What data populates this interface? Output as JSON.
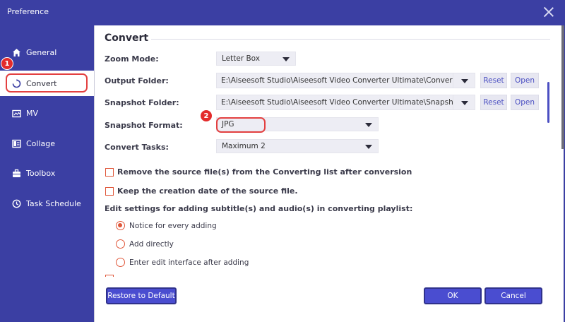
{
  "window": {
    "title": "Preference"
  },
  "sidebar": {
    "items": [
      {
        "label": "General",
        "icon": "home-icon"
      },
      {
        "label": "Convert",
        "icon": "convert-icon"
      },
      {
        "label": "MV",
        "icon": "mv-icon"
      },
      {
        "label": "Collage",
        "icon": "collage-icon"
      },
      {
        "label": "Toolbox",
        "icon": "toolbox-icon"
      },
      {
        "label": "Task Schedule",
        "icon": "clock-icon"
      }
    ],
    "active": "Convert"
  },
  "convert": {
    "section_title": "Convert",
    "zoom_mode": {
      "label": "Zoom Mode:",
      "value": "Letter Box"
    },
    "output_folder": {
      "label": "Output Folder:",
      "value": "E:\\Aiseesoft Studio\\Aiseesoft Video Converter Ultimate\\Converted",
      "reset": "Reset",
      "open": "Open"
    },
    "snapshot_folder": {
      "label": "Snapshot Folder:",
      "value": "E:\\Aiseesoft Studio\\Aiseesoft Video Converter Ultimate\\Snapshot",
      "reset": "Reset",
      "open": "Open"
    },
    "snapshot_format": {
      "label": "Snapshot Format:",
      "value": "JPG"
    },
    "convert_tasks": {
      "label": "Convert Tasks:",
      "value": "Maximum 2"
    },
    "remove_source": {
      "label": "Remove the source file(s) from the Converting list after conversion",
      "checked": false
    },
    "keep_date": {
      "label": "Keep the creation date of the source file.",
      "checked": false
    },
    "subtitle_settings": {
      "label": "Edit settings for adding subtitle(s) and audio(s) in converting playlist:",
      "options": [
        {
          "label": "Notice for every adding",
          "checked": true
        },
        {
          "label": "Add directly",
          "checked": false
        },
        {
          "label": "Enter edit interface after adding",
          "checked": false
        }
      ]
    }
  },
  "footer": {
    "restore": "Restore to Default",
    "ok": "OK",
    "cancel": "Cancel"
  },
  "annotations": {
    "step1": "1",
    "step2": "2"
  },
  "colors": {
    "sidebar": "#3b3fa3",
    "accent": "#4a4dd0",
    "checkbox": "#e0573a",
    "annotation": "#e32b2b"
  }
}
